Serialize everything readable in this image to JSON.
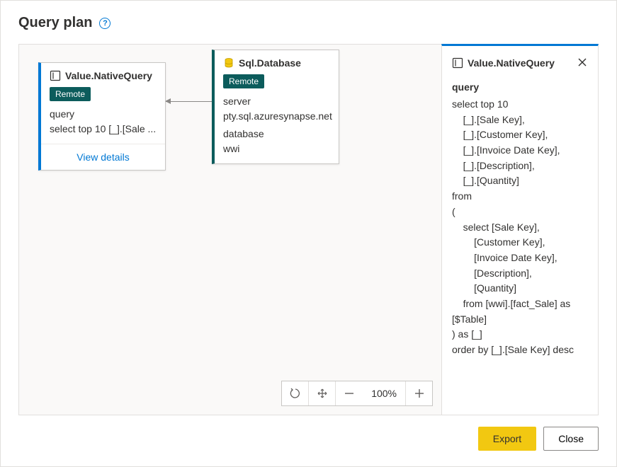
{
  "header": {
    "title": "Query plan"
  },
  "nodes": {
    "nativeQuery": {
      "title": "Value.NativeQuery",
      "badge": "Remote",
      "label_query": "query",
      "query_preview": "select top 10 [_].[Sale ...",
      "view_details": "View details"
    },
    "sqlDatabase": {
      "title": "Sql.Database",
      "badge": "Remote",
      "label_server": "server",
      "server": "pty.sql.azuresynapse.net",
      "label_database": "database",
      "database": "wwi"
    }
  },
  "zoom": {
    "percent": "100%"
  },
  "detail": {
    "title": "Value.NativeQuery",
    "label_query": "query",
    "query_text": "select top 10\n    [_].[Sale Key],\n    [_].[Customer Key],\n    [_].[Invoice Date Key],\n    [_].[Description],\n    [_].[Quantity]\nfrom\n(\n    select [Sale Key],\n        [Customer Key],\n        [Invoice Date Key],\n        [Description],\n        [Quantity]\n    from [wwi].[fact_Sale] as [$Table]\n) as [_]\norder by [_].[Sale Key] desc"
  },
  "footer": {
    "export": "Export",
    "close": "Close"
  }
}
